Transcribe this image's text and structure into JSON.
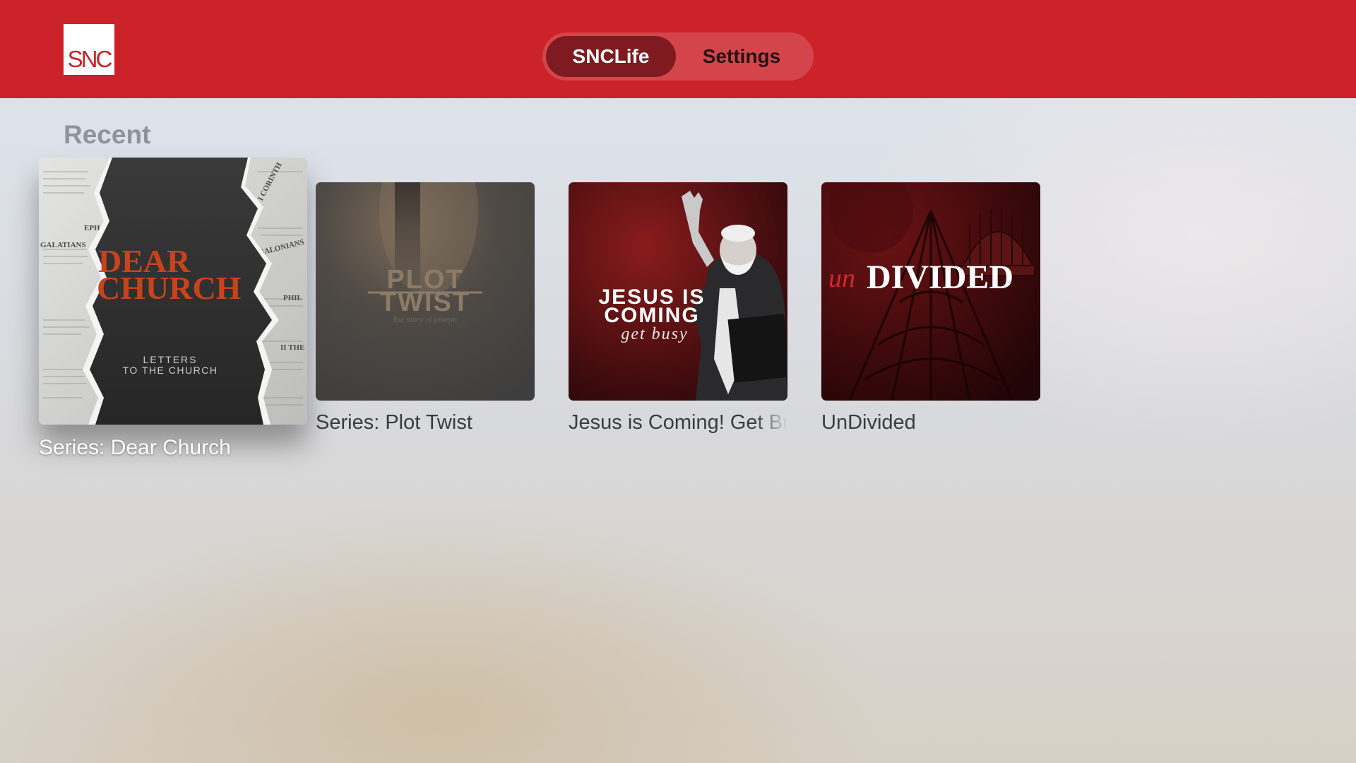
{
  "header": {
    "logo_text": "SNC",
    "tabs": [
      {
        "label": "SNCLife",
        "active": true
      },
      {
        "label": "Settings",
        "active": false
      }
    ]
  },
  "colors": {
    "brand_red": "#cc2229",
    "active_tab": "#7f1b20"
  },
  "recent": {
    "title": "Recent",
    "items": [
      {
        "title": "Series: Dear Church",
        "focused": true,
        "art_text": {
          "line1": "DEAR",
          "line2": "CHURCH",
          "sub1": "LETTERS",
          "sub2": "TO THE CHURCH",
          "words": [
            "GALATIANS",
            "EPH",
            "I CORINTH",
            "SALONIANS",
            "PHIL",
            "II THE"
          ]
        }
      },
      {
        "title": "Series: Plot Twist",
        "focused": false,
        "art_text": {
          "line1": "PLOT",
          "line2": "TWIST",
          "sub": "the story of joseph"
        }
      },
      {
        "title": "Jesus is Coming! Get Busy",
        "focused": false,
        "art_text": {
          "line1": "JESUS IS",
          "line2": "COMING",
          "sub": "get busy"
        }
      },
      {
        "title": "UnDivided",
        "focused": false,
        "art_text": {
          "prefix": "un",
          "main": "DIVIDED"
        }
      }
    ]
  }
}
